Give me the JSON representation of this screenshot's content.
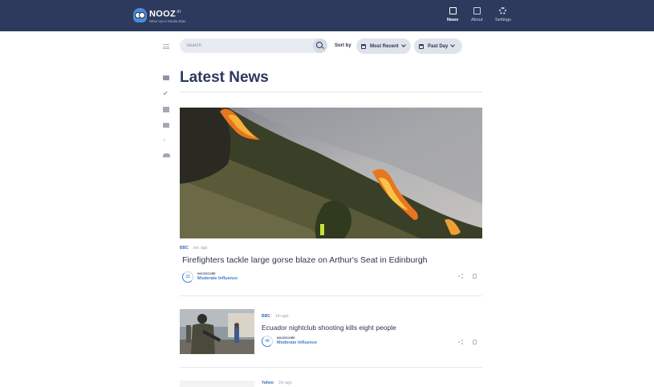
{
  "brand": {
    "name": "NOOZ",
    "superscript": "AI",
    "tagline": "Wise Up to Media Bias"
  },
  "nav": [
    {
      "label": "News",
      "icon": "news-icon",
      "active": true
    },
    {
      "label": "About",
      "icon": "external-link-icon",
      "active": false
    },
    {
      "label": "Settings",
      "icon": "gear-icon",
      "active": false
    }
  ],
  "sidebar": [
    {
      "icon": "menu-icon"
    },
    {
      "icon": "newspaper-icon"
    },
    {
      "icon": "check-icon"
    },
    {
      "icon": "building-icon"
    },
    {
      "icon": "org-chart-icon"
    },
    {
      "icon": "rss-icon"
    },
    {
      "icon": "people-icon"
    }
  ],
  "search": {
    "placeholder": "Search",
    "value": ""
  },
  "sort": {
    "label": "Sort by",
    "order": "Most Recent",
    "range": "Past Day"
  },
  "page_title": "Latest News",
  "articles": [
    {
      "source": "BBC",
      "time": "sec ago",
      "headline": "Firefighters tackle large gorse blaze on Arthur's Seat in Edinburgh",
      "score": "33",
      "score_brand": "NOOZSCORE",
      "influence": "Moderate Influence"
    },
    {
      "source": "BBC",
      "time": "1m ago",
      "headline": "Ecuador nightclub shooting kills eight people",
      "score": "48",
      "score_brand": "NOOZSCORE",
      "influence": "Moderate Influence"
    },
    {
      "source": "Yahoo",
      "time": "2m ago"
    }
  ],
  "colors": {
    "header": "#2d3a5e",
    "accent": "#3a7fd0",
    "text": "#2d3450"
  }
}
